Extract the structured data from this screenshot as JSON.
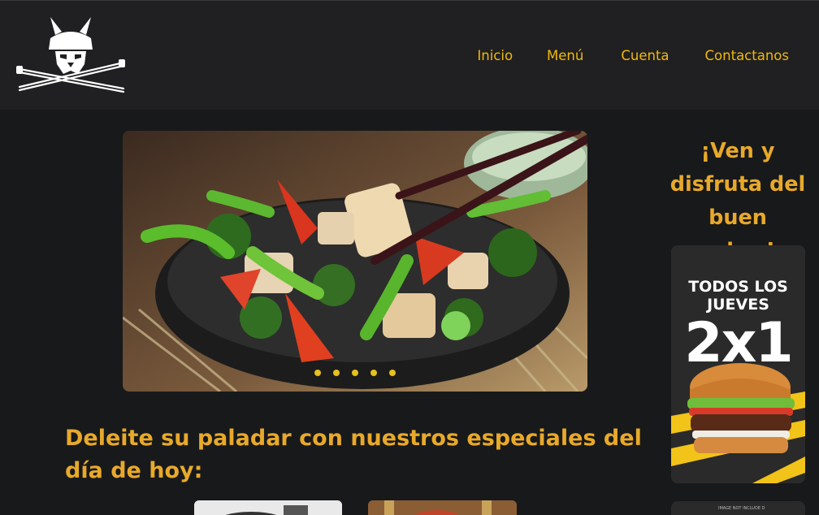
{
  "header": {
    "logo_icon": "samurai-helmet-crossed-katanas-logo",
    "nav": [
      {
        "label": "Inicio"
      },
      {
        "label": "Menú"
      },
      {
        "label": "Cuenta"
      },
      {
        "label": "Contactanos"
      }
    ]
  },
  "carousel": {
    "image": "stir-fry-bowl-chopsticks",
    "dot_count": 5,
    "dot_color": "#e6c21a"
  },
  "main": {
    "headline": "Deleite su paladar con nuestros especiales del día de hoy:"
  },
  "promo": {
    "title": "¡Ven y disfruta del buen sabor!",
    "banner": {
      "line1": "TODOS LOS JUEVES",
      "big": "2x1",
      "image": "burger-illustration"
    },
    "banner2_text": "IMAGE NOT INCLUDE D"
  },
  "colors": {
    "accent": "#f0b90b",
    "heading": "#e8a92a",
    "background": "#18191b",
    "header_bg": "#202022"
  }
}
